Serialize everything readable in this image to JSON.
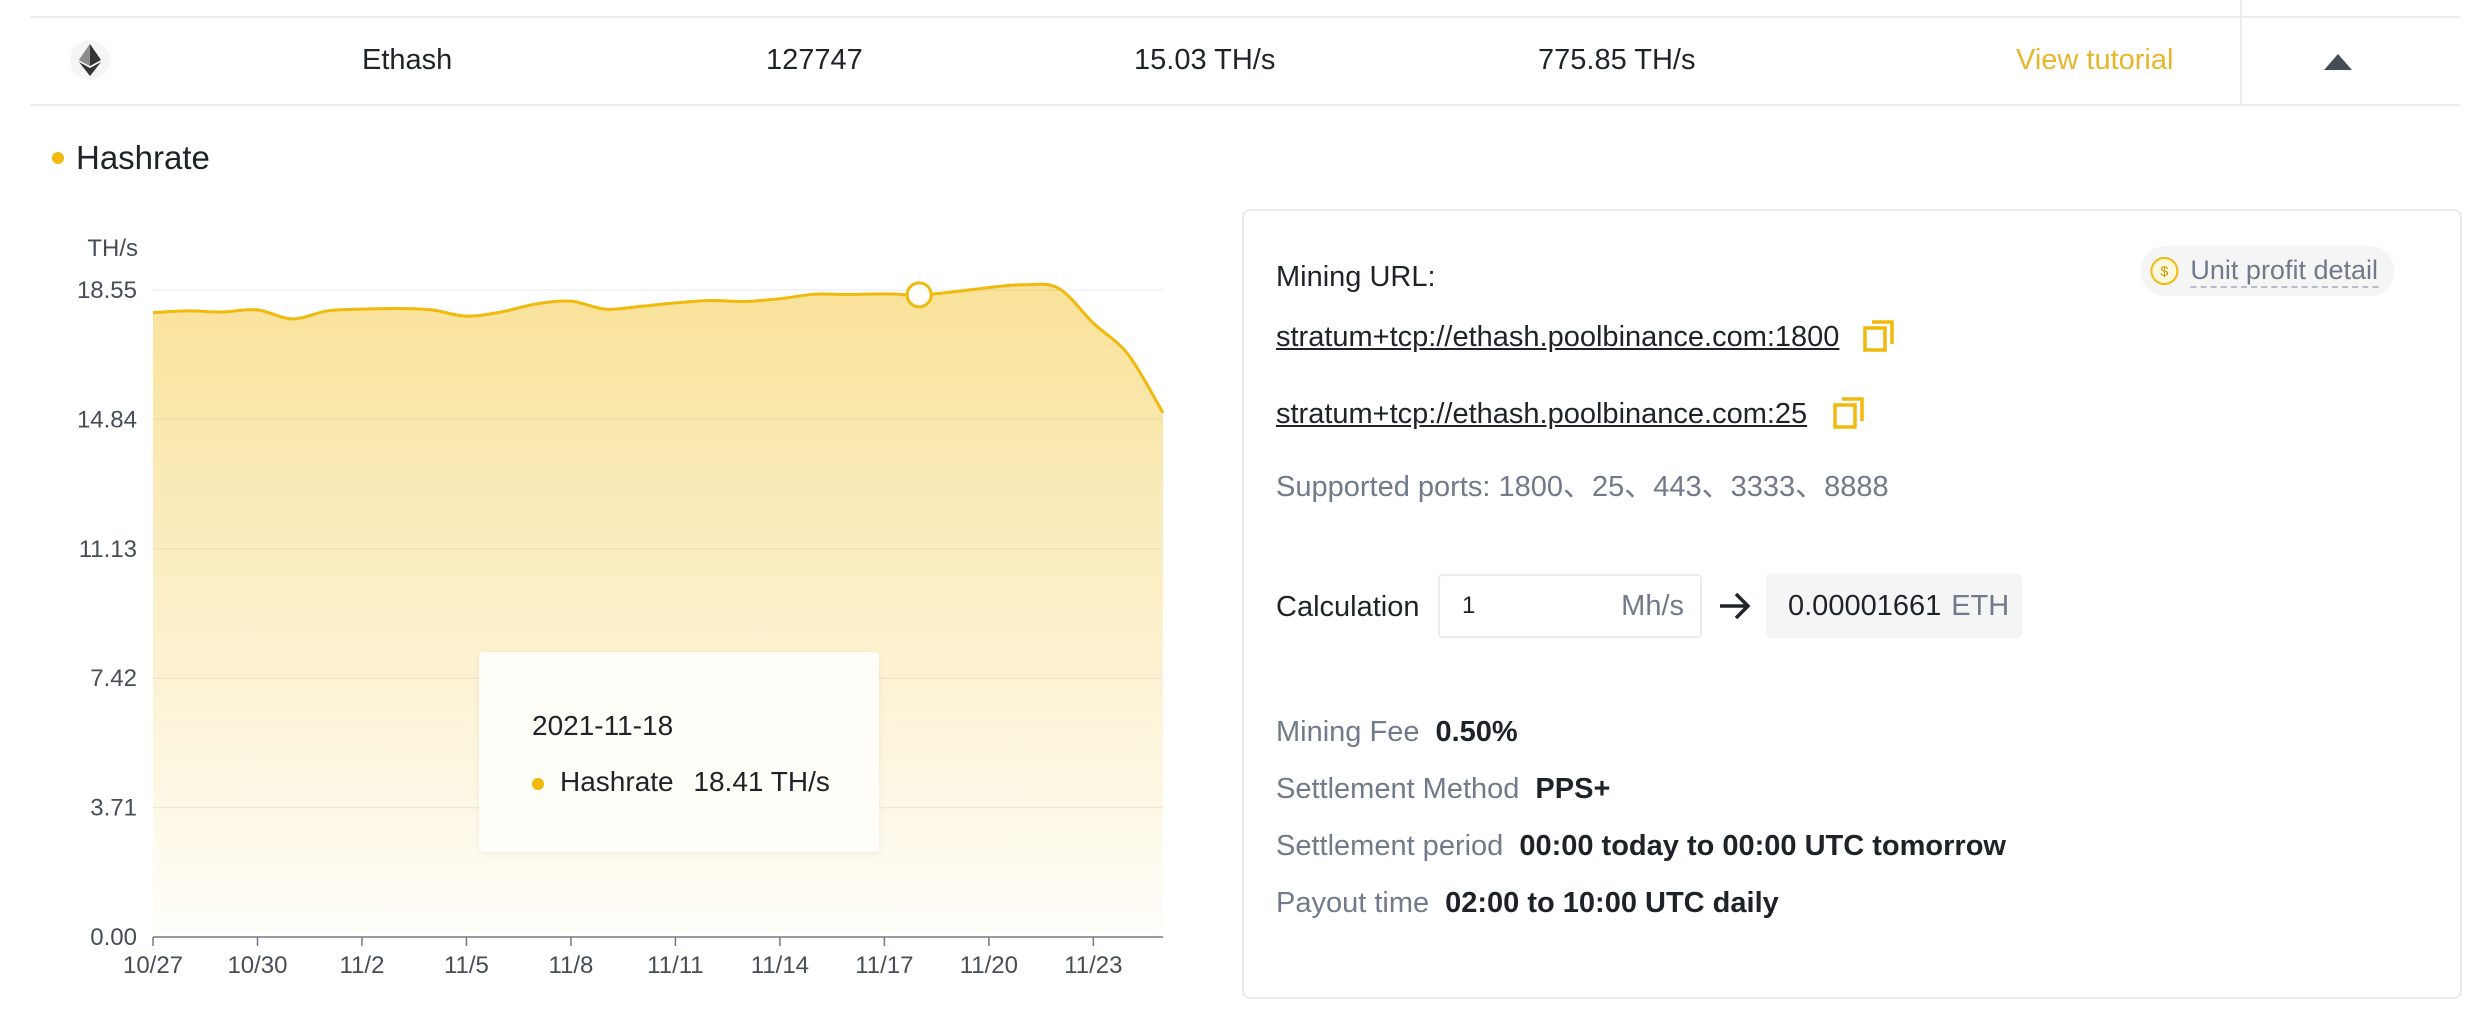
{
  "pool_row": {
    "coin_icon": "ethereum-icon",
    "algorithm": "Ethash",
    "workers": "127747",
    "my_hashrate": "15.03 TH/s",
    "pool_hashrate": "775.85 TH/s",
    "tutorial_link": "View tutorial",
    "collapse_icon": "caret-up-icon"
  },
  "section": {
    "title": "Hashrate"
  },
  "chart_data": {
    "type": "area",
    "title": "",
    "ylabel": "TH/s",
    "ylim": [
      0,
      18.55
    ],
    "yticks": [
      0.0,
      3.71,
      7.42,
      11.13,
      14.84,
      18.55
    ],
    "x_start": "10/27",
    "x_tick_labels": [
      "10/27",
      "10/30",
      "11/2",
      "11/5",
      "11/8",
      "11/11",
      "11/14",
      "11/17",
      "11/20",
      "11/23"
    ],
    "x_tick_dates": [
      "2021-10-27",
      "2021-10-30",
      "2021-11-02",
      "2021-11-05",
      "2021-11-08",
      "2021-11-11",
      "2021-11-14",
      "2021-11-17",
      "2021-11-20",
      "2021-11-23"
    ],
    "x_end_date": "2021-11-25",
    "series": [
      {
        "name": "Hashrate",
        "color": "#f0b90b",
        "points": [
          [
            "2021-10-27",
            17.9
          ],
          [
            "2021-10-28",
            17.95
          ],
          [
            "2021-10-29",
            17.92
          ],
          [
            "2021-10-30",
            17.98
          ],
          [
            "2021-10-31",
            17.72
          ],
          [
            "2021-11-01",
            17.95
          ],
          [
            "2021-11-02",
            18.0
          ],
          [
            "2021-11-03",
            18.02
          ],
          [
            "2021-11-04",
            17.98
          ],
          [
            "2021-11-05",
            17.8
          ],
          [
            "2021-11-06",
            17.92
          ],
          [
            "2021-11-07",
            18.15
          ],
          [
            "2021-11-08",
            18.23
          ],
          [
            "2021-11-09",
            18.0
          ],
          [
            "2021-11-10",
            18.08
          ],
          [
            "2021-11-11",
            18.18
          ],
          [
            "2021-11-12",
            18.25
          ],
          [
            "2021-11-13",
            18.22
          ],
          [
            "2021-11-14",
            18.3
          ],
          [
            "2021-11-15",
            18.43
          ],
          [
            "2021-11-16",
            18.42
          ],
          [
            "2021-11-17",
            18.44
          ],
          [
            "2021-11-18",
            18.41
          ],
          [
            "2021-11-19",
            18.5
          ],
          [
            "2021-11-20",
            18.62
          ],
          [
            "2021-11-21",
            18.7
          ],
          [
            "2021-11-22",
            18.6
          ],
          [
            "2021-11-23",
            17.6
          ],
          [
            "2021-11-24",
            16.7
          ],
          [
            "2021-11-25",
            15.03
          ]
        ]
      }
    ],
    "highlight": {
      "date": "2021-11-18",
      "value": 18.41
    },
    "grid": true,
    "legend": "none"
  },
  "tooltip": {
    "date": "2021-11-18",
    "series_name": "Hashrate",
    "value": "18.41 TH/s"
  },
  "panel": {
    "unit_profit_button": "Unit profit detail",
    "unit_profit_icon": "coin-icon",
    "unit_profit_icon_glyph": "$",
    "mining_url_label": "Mining URL:",
    "urls": [
      "stratum+tcp://ethash.poolbinance.com:1800",
      "stratum+tcp://ethash.poolbinance.com:25"
    ],
    "supported_ports": "Supported ports: 1800、25、443、3333、8888",
    "calculation": {
      "label": "Calculation",
      "input_value": "1",
      "input_unit": "Mh/s",
      "result_value": "0.00001661",
      "result_currency": "ETH"
    },
    "mining_fee": {
      "label": "Mining Fee",
      "value": "0.50%"
    },
    "settlement_method": {
      "label": "Settlement Method",
      "value": "PPS+"
    },
    "settlement_period": {
      "label": "Settlement period",
      "value": "00:00 today to 00:00 UTC tomorrow"
    },
    "payout_time": {
      "label": "Payout time",
      "value": "02:00 to 10:00 UTC daily"
    }
  },
  "colors": {
    "accent": "#f0b90b",
    "link": "#e8b62a",
    "border": "#eaecef",
    "muted": "#707a8a"
  }
}
